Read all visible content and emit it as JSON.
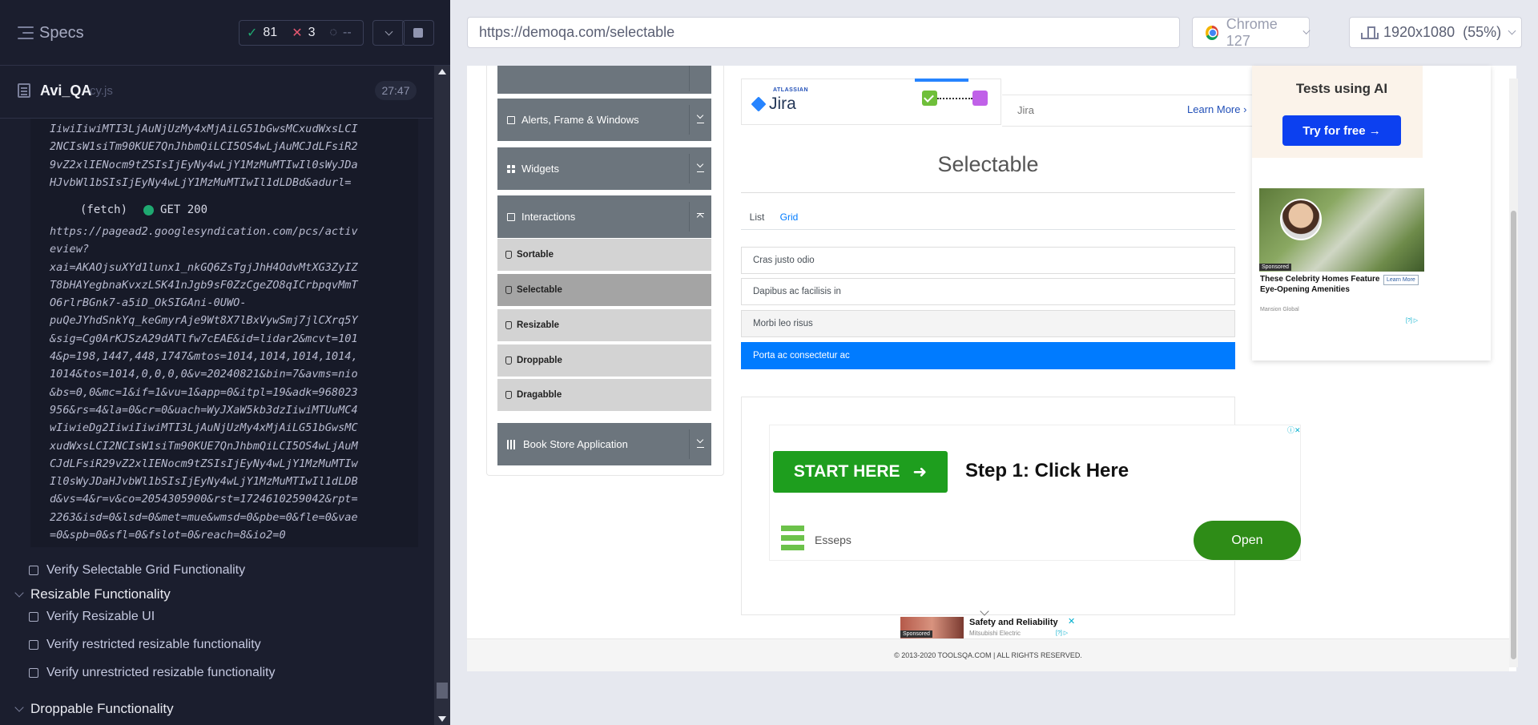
{
  "reporter": {
    "specs_label": "Specs",
    "stats": {
      "passed": "81",
      "failed": "3",
      "pending": "--"
    },
    "spec_file": {
      "name": "Avi_QA",
      "ext": "cy.js",
      "duration": "27:47"
    },
    "log_top_lines": "IiwiIiwiMTI3LjAuNjUzMy4xMjAiLG51bGwsMCxudWxsLCI\n2NCIsW1siTm90KUE7QnJhbmQiLCI5OS4wLjAuMCJdLFsiR2\n9vZ2xlIENocm9tZSIsIjEyNy4wLjY1MzMuMTIwIl0sWyJDa\nHJvbWl1bSIsIjEyNy4wLjY1MzMuMTIwIl1dLDBd&adurl=",
    "log_fetch_label": "(fetch)",
    "log_fetch_status": "GET 200",
    "log_bottom_lines": "https://pagead2.googlesyndication.com/pcs/activ\neview?\nxai=AKAOjsuXYd1lunx1_nkGQ6ZsTgjJhH4OdvMtXG3ZyIZ\nT8bHAYegbnaKvxzLSK41nJgb9sF0ZzCgeZO8qICrbpqvMmT\nO6rlrBGnk7-a5iD_OkSIGAni-0UWO-\npuQeJYhdSnkYq_keGmyrAje9Wt8X7lBxVywSmj7jlCXrq5Y\n&sig=Cg0ArKJSzA29dATlfw7cEAE&id=lidar2&mcvt=101\n4&p=198,1447,448,1747&mtos=1014,1014,1014,1014,\n1014&tos=1014,0,0,0,0&v=20240821&bin=7&avms=nio\n&bs=0,0&mc=1&if=1&vu=1&app=0&itpl=19&adk=968023\n956&rs=4&la=0&cr=0&uach=WyJXaW5kb3dzIiwiMTUuMC4\nwIiwieDg2IiwiIiwiMTI3LjAuNjUzMy4xMjAiLG51bGwsMC\nxudWxsLCI2NCIsW1siTm90KUE7QnJhbmQiLCI5OS4wLjAuM\nCJdLFsiR29vZ2xlIENocm9tZSIsIjEyNy4wLjY1MzMuMTIw\nIl0sWyJDaHJvbWl1bSIsIjEyNy4wLjY1MzMuMTIwIl1dLDB\nd&vs=4&r=v&co=2054305900&rst=1724610259042&rpt=\n2263&isd=0&lsd=0&met=mue&wmsd=0&pbe=0&fle=0&vae\n=0&spb=0&sfl=0&fslot=0&reach=8&io2=0",
    "tests": [
      {
        "label": "Verify Selectable Grid Functionality"
      },
      {
        "label": "Verify Resizable UI"
      },
      {
        "label": "Verify restricted resizable functionality"
      },
      {
        "label": "Verify unrestricted resizable functionality"
      }
    ],
    "suites": [
      {
        "label": "Resizable Functionality"
      },
      {
        "label": "Droppable Functionality"
      }
    ]
  },
  "browser": {
    "url": "https://demoqa.com/selectable",
    "browser_name": "Chrome 127",
    "viewport": "1920x1080",
    "zoom": "(55%)"
  },
  "menu": {
    "groups": [
      {
        "label": "Alerts, Frame & Windows"
      },
      {
        "label": "Widgets"
      },
      {
        "label": "Interactions"
      },
      {
        "label": "Book Store Application"
      }
    ],
    "interaction_items": [
      {
        "label": "Sortable"
      },
      {
        "label": "Selectable"
      },
      {
        "label": "Resizable"
      },
      {
        "label": "Droppable"
      },
      {
        "label": "Dragabble"
      }
    ]
  },
  "jira_ad": {
    "atlassian": "ATLASSIAN",
    "logo": "Jira",
    "name": "Jira",
    "learn_more": "Learn More"
  },
  "page": {
    "title": "Selectable",
    "tabs": [
      {
        "label": "List"
      },
      {
        "label": "Grid"
      }
    ],
    "items": [
      {
        "label": "Cras justo odio"
      },
      {
        "label": "Dapibus ac facilisis in"
      },
      {
        "label": "Morbi leo risus"
      },
      {
        "label": "Porta ac consectetur ac"
      }
    ]
  },
  "main_ad": {
    "cta": "START HERE",
    "step": "Step 1: Click Here",
    "brand": "Esseps",
    "open": "Open"
  },
  "side_ad": {
    "title": "Tests using AI",
    "try_button": "Try for free →",
    "sponsored": "Sponsored",
    "headline": "These Celebrity Homes Feature Eye-Opening Amenities",
    "learn_more": "Learn More",
    "source": "Mansion Global",
    "adchoice": "[?] ▷"
  },
  "bottom_ad": {
    "sponsored": "Sponsored",
    "title": "Safety and Reliability",
    "source": "Mitsubishi Electric",
    "info": "[?] ▷",
    "close": "✕"
  },
  "footer": {
    "text": "© 2013-2020 TOOLSQA.COM | ALL RIGHTS RESERVED."
  },
  "colors": {
    "reporter_bg": "#1b1e2e",
    "pass": "#1fa971",
    "fail": "#e45770",
    "selected_item": "#007bff",
    "menu_group": "#6c757d"
  }
}
